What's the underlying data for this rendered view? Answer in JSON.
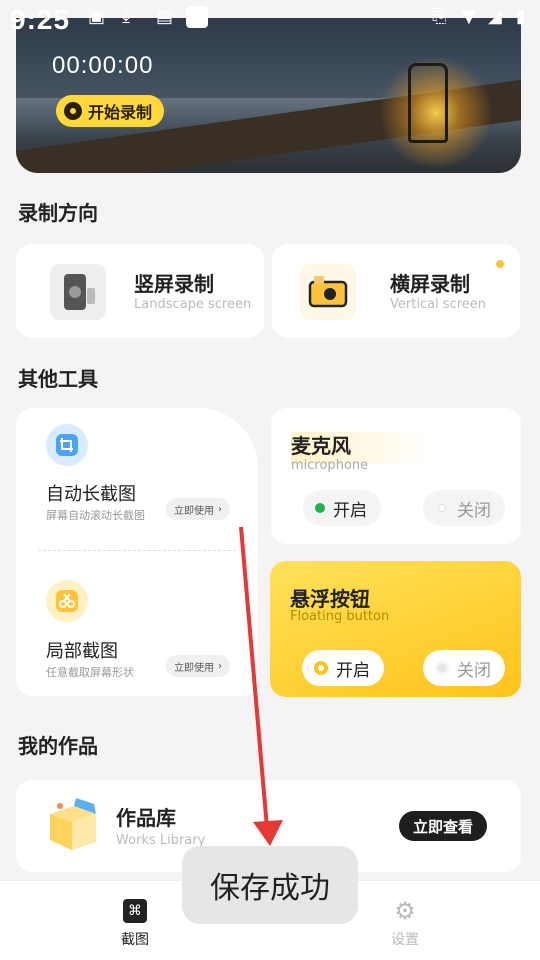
{
  "status_bar": {
    "time": "9:25"
  },
  "hero": {
    "timer": "00:00:00",
    "record_label": "开始录制"
  },
  "sections": {
    "orientation": "录制方向",
    "tools": "其他工具",
    "works": "我的作品"
  },
  "orientation": {
    "portrait": {
      "title": "竖屏录制",
      "subtitle": "Landscape screen"
    },
    "landscape": {
      "title": "横屏录制",
      "subtitle": "Vertical screen"
    }
  },
  "tools": {
    "long_screenshot": {
      "title": "自动长截图",
      "subtitle": "屏幕自动滚动长截图",
      "action": "立即使用"
    },
    "partial_screenshot": {
      "title": "局部截图",
      "subtitle": "任意截取屏幕形状",
      "action": "立即使用"
    },
    "microphone": {
      "title": "麦克风",
      "subtitle": "microphone",
      "on": "开启",
      "off": "关闭",
      "selected": "on"
    },
    "floating_button": {
      "title": "悬浮按钮",
      "subtitle": "Floating button",
      "on": "开启",
      "off": "关闭",
      "selected": "on"
    }
  },
  "works": {
    "title": "作品库",
    "subtitle": "Works Library",
    "action": "立即查看"
  },
  "toast": "保存成功",
  "bottom_nav": [
    {
      "label": "截图",
      "icon": "screenshot-icon",
      "active": true
    },
    {
      "label": "设置",
      "icon": "gear-icon",
      "active": false
    }
  ],
  "colors": {
    "accent": "#ffd83a",
    "active_green": "#22b14c",
    "arrow": "#e53935"
  }
}
